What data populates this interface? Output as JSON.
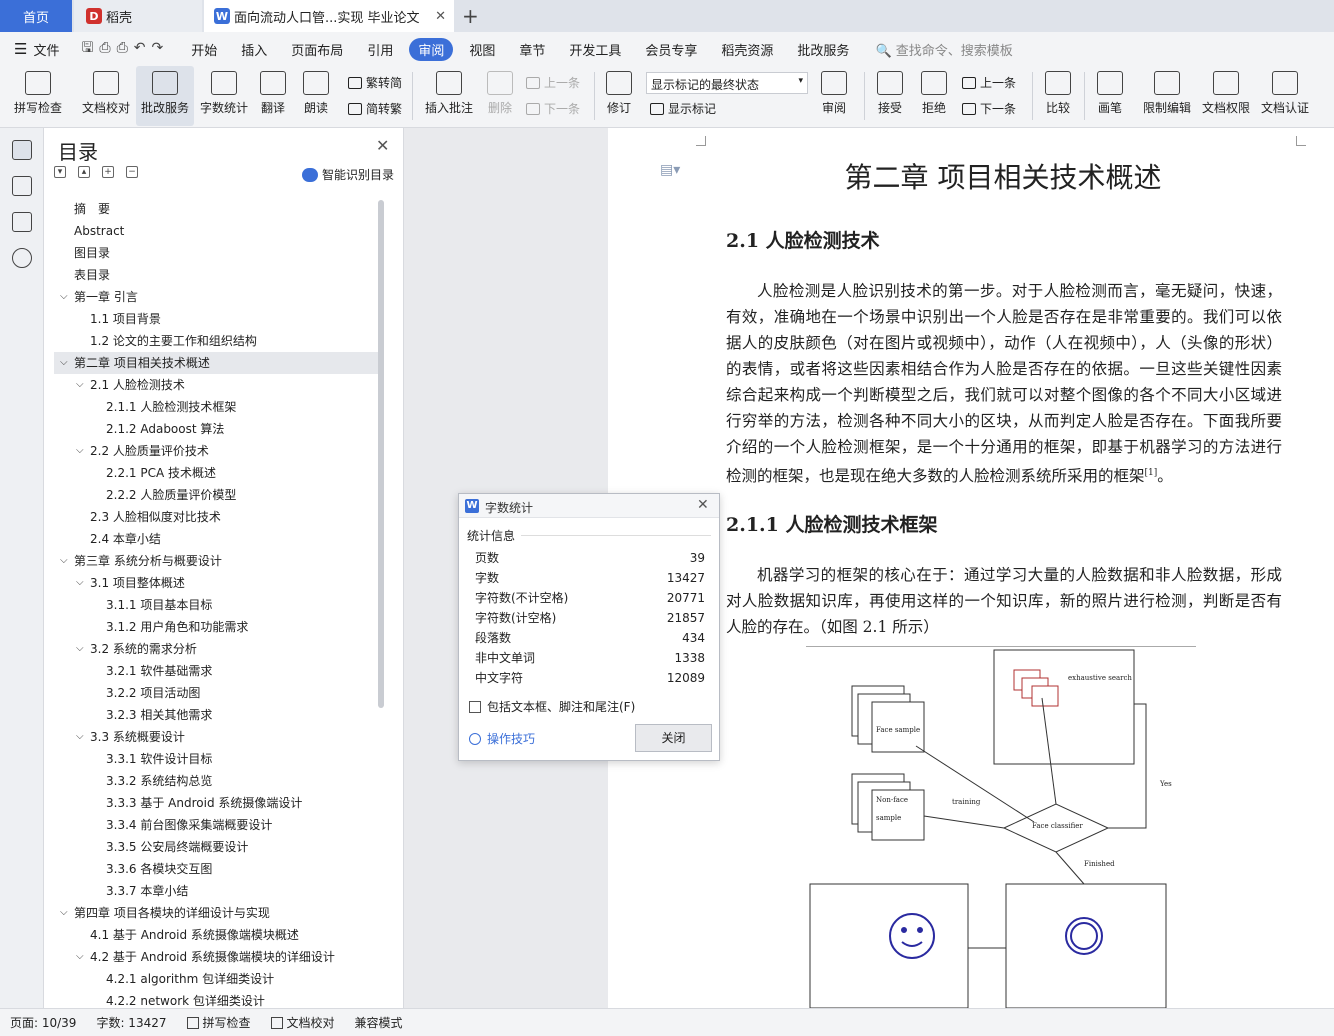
{
  "tabs": {
    "home": "首页",
    "daoke": "稻壳",
    "doc": "面向流动人口管...实现 毕业论文"
  },
  "menu": {
    "file": "文件",
    "items": [
      "开始",
      "插入",
      "页面布局",
      "引用",
      "审阅",
      "视图",
      "章节",
      "开发工具",
      "会员专享",
      "稻壳资源",
      "批改服务"
    ],
    "active": "审阅",
    "search_placeholder": "查找命令、搜索模板"
  },
  "ribbon": {
    "spell": "拼写检查",
    "proofread": "文档校对",
    "correct": "批改服务",
    "wordcount": "字数统计",
    "translate": "翻译",
    "read": "朗读",
    "trad": "繁转简",
    "simp": "简转繁",
    "insert_comment": "插入批注",
    "delete": "删除",
    "prev": "上一条",
    "next": "下一条",
    "revise": "修订",
    "markup_state": "显示标记的最终状态",
    "show_markup": "显示标记",
    "review": "审阅",
    "accept": "接受",
    "reject": "拒绝",
    "prev2": "上一条",
    "next2": "下一条",
    "compare": "比较",
    "pen": "画笔",
    "restrict": "限制编辑",
    "perm": "文档权限",
    "cert": "文档认证"
  },
  "toc": {
    "title": "目录",
    "smart": "智能识别目录",
    "items": [
      {
        "text": "摘　要",
        "level": 0,
        "exp": false
      },
      {
        "text": "Abstract",
        "level": 0,
        "exp": false
      },
      {
        "text": "图目录",
        "level": 0,
        "exp": false
      },
      {
        "text": "表目录",
        "level": 0,
        "exp": false
      },
      {
        "text": "第一章 引言",
        "level": 0,
        "exp": true
      },
      {
        "text": "1.1 项目背景",
        "level": 1,
        "exp": false
      },
      {
        "text": "1.2 论文的主要工作和组织结构",
        "level": 1,
        "exp": false
      },
      {
        "text": "第二章 项目相关技术概述",
        "level": 0,
        "exp": true,
        "sel": true
      },
      {
        "text": "2.1 人脸检测技术",
        "level": 1,
        "exp": true
      },
      {
        "text": "2.1.1 人脸检测技术框架",
        "level": 2,
        "exp": false
      },
      {
        "text": "2.1.2 Adaboost 算法",
        "level": 2,
        "exp": false
      },
      {
        "text": "2.2 人脸质量评价技术",
        "level": 1,
        "exp": true
      },
      {
        "text": "2.2.1 PCA 技术概述",
        "level": 2,
        "exp": false
      },
      {
        "text": "2.2.2 人脸质量评价模型",
        "level": 2,
        "exp": false
      },
      {
        "text": "2.3 人脸相似度对比技术",
        "level": 1,
        "exp": false
      },
      {
        "text": "2.4 本章小结",
        "level": 1,
        "exp": false
      },
      {
        "text": "第三章 系统分析与概要设计",
        "level": 0,
        "exp": true
      },
      {
        "text": "3.1 项目整体概述",
        "level": 1,
        "exp": true
      },
      {
        "text": "3.1.1 项目基本目标",
        "level": 2,
        "exp": false
      },
      {
        "text": "3.1.2 用户角色和功能需求",
        "level": 2,
        "exp": false
      },
      {
        "text": "3.2 系统的需求分析",
        "level": 1,
        "exp": true
      },
      {
        "text": "3.2.1 软件基础需求",
        "level": 2,
        "exp": false
      },
      {
        "text": "3.2.2 项目活动图",
        "level": 2,
        "exp": false
      },
      {
        "text": "3.2.3 相关其他需求",
        "level": 2,
        "exp": false
      },
      {
        "text": "3.3 系统概要设计",
        "level": 1,
        "exp": true
      },
      {
        "text": "3.3.1 软件设计目标",
        "level": 2,
        "exp": false
      },
      {
        "text": "3.3.2 系统结构总览",
        "level": 2,
        "exp": false
      },
      {
        "text": "3.3.3 基于 Android 系统摄像端设计",
        "level": 2,
        "exp": false
      },
      {
        "text": "3.3.4 前台图像采集端概要设计",
        "level": 2,
        "exp": false
      },
      {
        "text": "3.3.5 公安局终端概要设计",
        "level": 2,
        "exp": false
      },
      {
        "text": "3.3.6 各模块交互图",
        "level": 2,
        "exp": false
      },
      {
        "text": "3.3.7 本章小结",
        "level": 2,
        "exp": false
      },
      {
        "text": "第四章 项目各模块的详细设计与实现",
        "level": 0,
        "exp": true
      },
      {
        "text": "4.1 基于 Android 系统摄像端模块概述",
        "level": 1,
        "exp": false
      },
      {
        "text": "4.2 基于 Android 系统摄像端模块的详细设计",
        "level": 1,
        "exp": true
      },
      {
        "text": "4.2.1 algorithm 包详细类设计",
        "level": 2,
        "exp": false
      },
      {
        "text": "4.2.2 network 包详细类设计",
        "level": 2,
        "exp": false
      }
    ]
  },
  "doc": {
    "chapter": "第二章  项目相关技术概述",
    "h21": "2.1  人脸检测技术",
    "p1": "人脸检测是人脸识别技术的第一步。对于人脸检测而言，毫无疑问，快速，有效，准确地在一个场景中识别出一个人脸是否存在是非常重要的。我们可以依据人的皮肤颜色（对在图片或视频中），动作（人在视频中），人（头像的形状）的表情，或者将这些因素相结合作为人脸是否存在的依据。一旦这些关键性因素综合起来构成一个判断模型之后，我们就可以对整个图像的各个不同大小区域进行穷举的方法，检测各种不同大小的区块，从而判定人脸是否存在。下面我所要介绍的一个人脸检测框架，是一个十分通用的框架，即基于机器学习的方法进行检测的框架，也是现在绝大多数的人脸检测系统所采用的框架",
    "p1_ref": "[1]",
    "p1_end": "。",
    "h211": "2.1.1 人脸检测技术框架",
    "p2": "机器学习的框架的核心在于：通过学习大量的人脸数据和非人脸数据，形成对人脸数据知识库，再使用这样的一个知识库，新的照片进行检测，判断是否有人脸的存在。（如图 2.1 所示）",
    "fig": {
      "face_sample": "Face sample",
      "nonface_sample_1": "Non-face",
      "nonface_sample_2": "sample",
      "training": "training",
      "classifier": "Face classifier",
      "exhaustive": "exhaustive search",
      "yes": "Yes",
      "finished": "Finished"
    }
  },
  "dialog": {
    "title": "字数统计",
    "section": "统计信息",
    "stats": [
      {
        "label": "页数",
        "value": "39"
      },
      {
        "label": "字数",
        "value": "13427"
      },
      {
        "label": "字符数(不计空格)",
        "value": "20771"
      },
      {
        "label": "字符数(计空格)",
        "value": "21857"
      },
      {
        "label": "段落数",
        "value": "434"
      },
      {
        "label": "非中文单词",
        "value": "1338"
      },
      {
        "label": "中文字符",
        "value": "12089"
      }
    ],
    "include": "包括文本框、脚注和尾注(F)",
    "tips": "操作技巧",
    "close": "关闭"
  },
  "status": {
    "page": "页面: 10/39",
    "words": "字数: 13427",
    "spell": "拼写检查",
    "proof": "文档校对",
    "compat": "兼容模式"
  },
  "colors": {
    "accent": "#3b6fd8",
    "wps_red": "#d0312d"
  }
}
